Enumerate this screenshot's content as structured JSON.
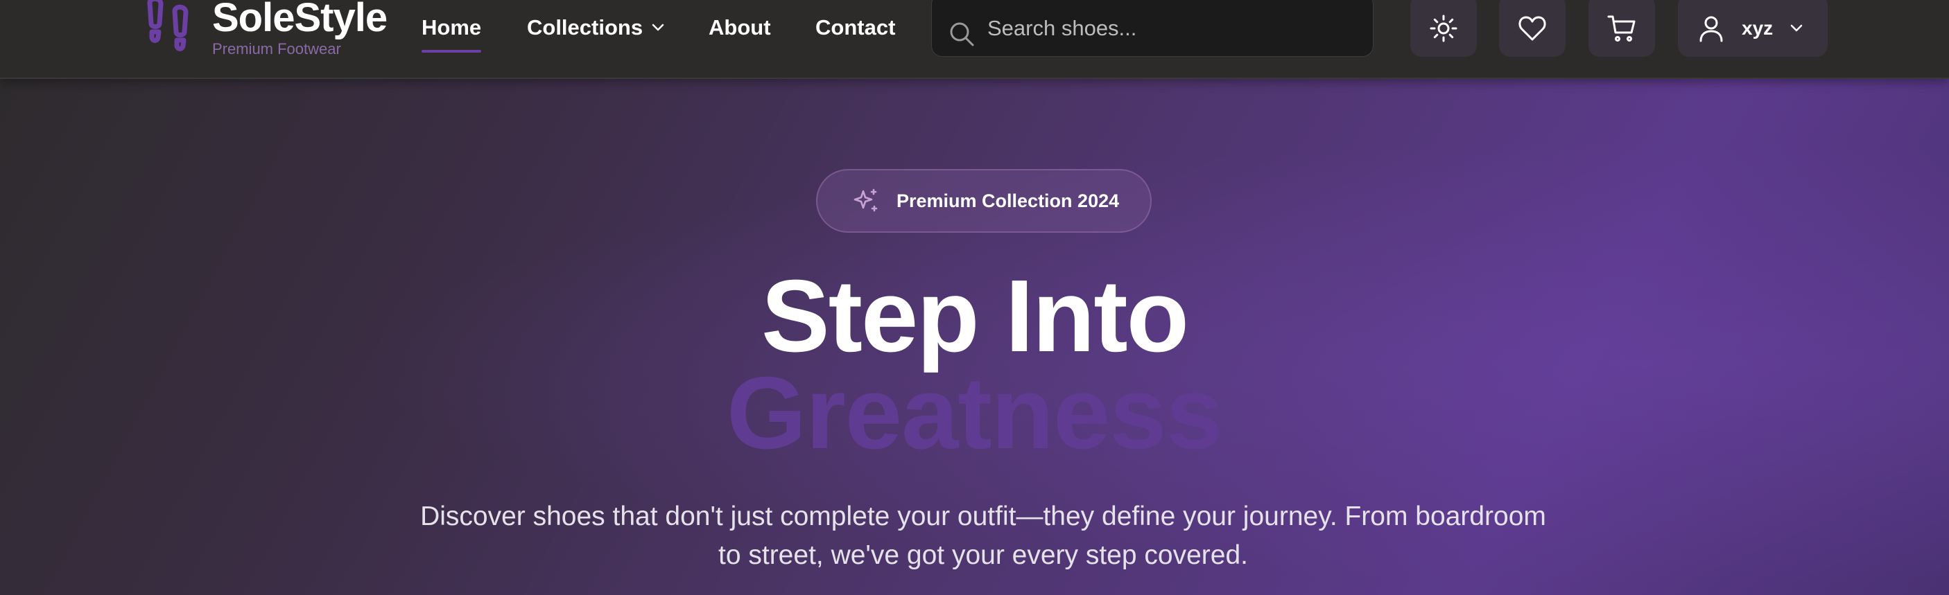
{
  "brand": {
    "name": "SoleStyle",
    "tagline": "Premium Footwear",
    "icon": "footprints-icon"
  },
  "nav": {
    "items": [
      {
        "label": "Home",
        "active": true
      },
      {
        "label": "Collections",
        "has_dropdown": true
      },
      {
        "label": "About"
      },
      {
        "label": "Contact"
      }
    ]
  },
  "search": {
    "placeholder": "Search shoes...",
    "value": "",
    "icon": "search-icon"
  },
  "actions": {
    "theme_icon": "sun-icon",
    "wishlist_icon": "heart-icon",
    "cart_icon": "cart-icon",
    "user": {
      "name": "xyz",
      "icon": "user-icon"
    }
  },
  "hero": {
    "badge": {
      "label": "Premium Collection 2024",
      "icon": "sparkles-icon"
    },
    "title_line_1": "Step Into",
    "title_line_2": "Greatness",
    "subtitle": "Discover shoes that don't just complete your outfit—they define your journey. From boardroom to street, we've got your every step covered."
  },
  "colors": {
    "accent": "#6b3fa3",
    "nav_bg": "#2d2b2a",
    "highlight_text": "#5f3c92"
  }
}
